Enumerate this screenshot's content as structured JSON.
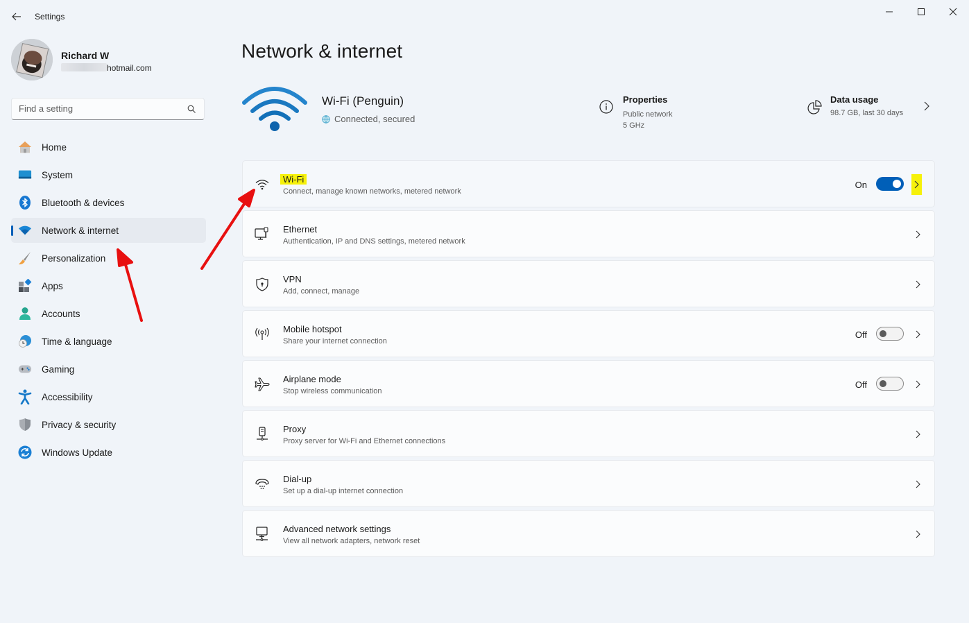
{
  "window": {
    "title": "Settings",
    "controls": [
      "minimize",
      "maximize",
      "close"
    ]
  },
  "profile": {
    "name": "Richard W",
    "email_visible": "hotmail.com"
  },
  "search": {
    "placeholder": "Find a setting",
    "value": ""
  },
  "sidebar": {
    "items": [
      {
        "label": "Home",
        "icon": "home-icon",
        "active": false
      },
      {
        "label": "System",
        "icon": "system-icon",
        "active": false
      },
      {
        "label": "Bluetooth & devices",
        "icon": "bluetooth-icon",
        "active": false
      },
      {
        "label": "Network & internet",
        "icon": "network-icon",
        "active": true
      },
      {
        "label": "Personalization",
        "icon": "brush-icon",
        "active": false
      },
      {
        "label": "Apps",
        "icon": "apps-icon",
        "active": false
      },
      {
        "label": "Accounts",
        "icon": "accounts-icon",
        "active": false
      },
      {
        "label": "Time & language",
        "icon": "time-language-icon",
        "active": false
      },
      {
        "label": "Gaming",
        "icon": "gaming-icon",
        "active": false
      },
      {
        "label": "Accessibility",
        "icon": "accessibility-icon",
        "active": false
      },
      {
        "label": "Privacy & security",
        "icon": "shield-icon",
        "active": false
      },
      {
        "label": "Windows Update",
        "icon": "update-icon",
        "active": false
      }
    ]
  },
  "main": {
    "title": "Network & internet",
    "connection": {
      "name": "Wi-Fi (Penguin)",
      "status": "Connected, secured"
    },
    "properties": {
      "title": "Properties",
      "line1": "Public network",
      "line2": "5 GHz"
    },
    "data_usage": {
      "title": "Data usage",
      "subtitle": "98.7 GB, last 30 days"
    },
    "cards": [
      {
        "title": "Wi-Fi",
        "subtitle": "Connect, manage known networks, metered network",
        "icon": "wifi-icon",
        "state": "On",
        "toggle": true
      },
      {
        "title": "Ethernet",
        "subtitle": "Authentication, IP and DNS settings, metered network",
        "icon": "ethernet-icon"
      },
      {
        "title": "VPN",
        "subtitle": "Add, connect, manage",
        "icon": "vpn-shield-icon"
      },
      {
        "title": "Mobile hotspot",
        "subtitle": "Share your internet connection",
        "icon": "hotspot-icon",
        "state": "Off",
        "toggle": false
      },
      {
        "title": "Airplane mode",
        "subtitle": "Stop wireless communication",
        "icon": "airplane-icon",
        "state": "Off",
        "toggle": false
      },
      {
        "title": "Proxy",
        "subtitle": "Proxy server for Wi-Fi and Ethernet connections",
        "icon": "proxy-icon"
      },
      {
        "title": "Dial-up",
        "subtitle": "Set up a dial-up internet connection",
        "icon": "dialup-icon"
      },
      {
        "title": "Advanced network settings",
        "subtitle": "View all network adapters, network reset",
        "icon": "advanced-network-icon"
      }
    ]
  },
  "colors": {
    "accent": "#005fb8",
    "highlight": "#f6f10a",
    "annotation_arrow": "#e81010"
  }
}
